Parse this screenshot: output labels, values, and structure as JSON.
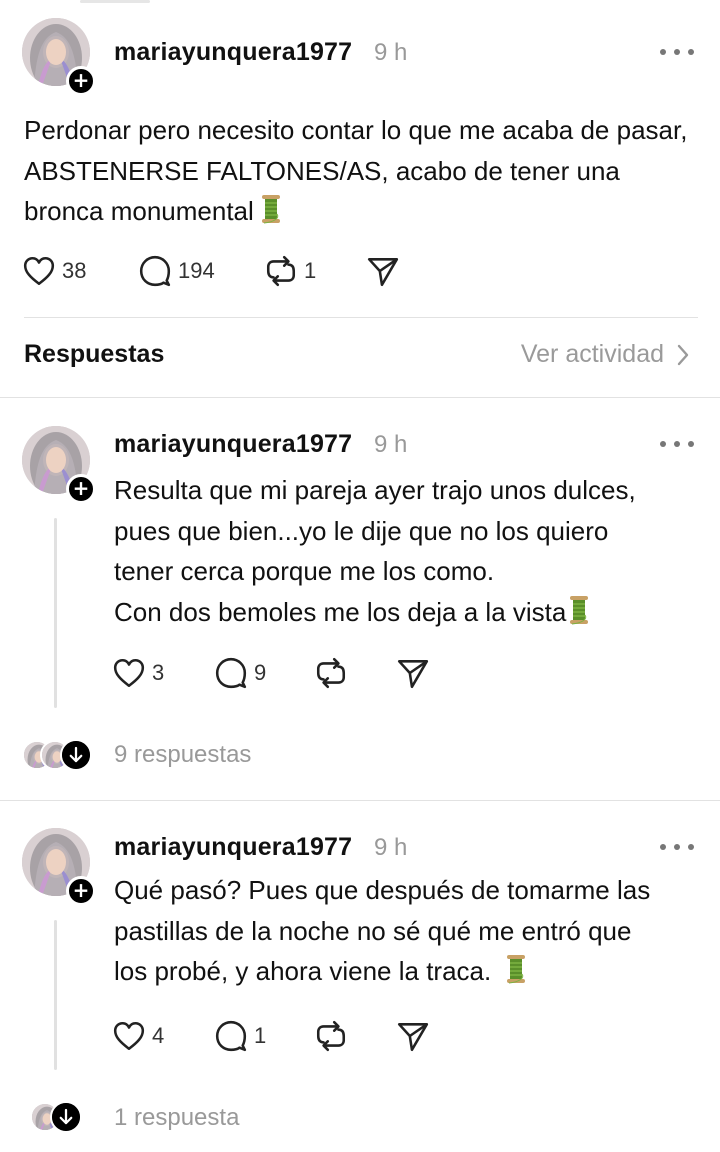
{
  "post": {
    "username": "mariayunquera1977",
    "time": "9 h",
    "text": "Perdonar pero necesito contar lo que me acaba de pasar, ABSTENERSE FALTONES/AS, acabo de tener una bronca monumental",
    "likes": "38",
    "comments": "194",
    "reposts": "1"
  },
  "section": {
    "title": "Respuestas",
    "activity_link": "Ver actividad"
  },
  "replies": [
    {
      "username": "mariayunquera1977",
      "time": "9 h",
      "line1": "Resulta que mi pareja ayer trajo unos dulces,",
      "line2": "pues que bien...yo le dije que no los quiero",
      "line3": "tener cerca porque me los como.",
      "line4": "Con dos bemoles me los deja a la vista",
      "likes": "3",
      "comments": "9",
      "replies_label": "9 respuestas"
    },
    {
      "username": "mariayunquera1977",
      "time": "9 h",
      "line1": "Qué pasó? Pues que después de tomarme las",
      "line2": "pastillas de la noche no sé qué me entró que",
      "line3": "los probé, y ahora viene la traca.",
      "likes": "4",
      "comments": "1",
      "replies_label": "1 respuesta"
    }
  ],
  "icons": {
    "like": "heart-icon",
    "comment": "comment-icon",
    "repost": "repost-icon",
    "share": "send-icon",
    "more": "more-icon",
    "emoji": "thread-spool-emoji"
  },
  "colors": {
    "text": "#111111",
    "muted": "#999999",
    "divider": "#e2e2e2"
  }
}
